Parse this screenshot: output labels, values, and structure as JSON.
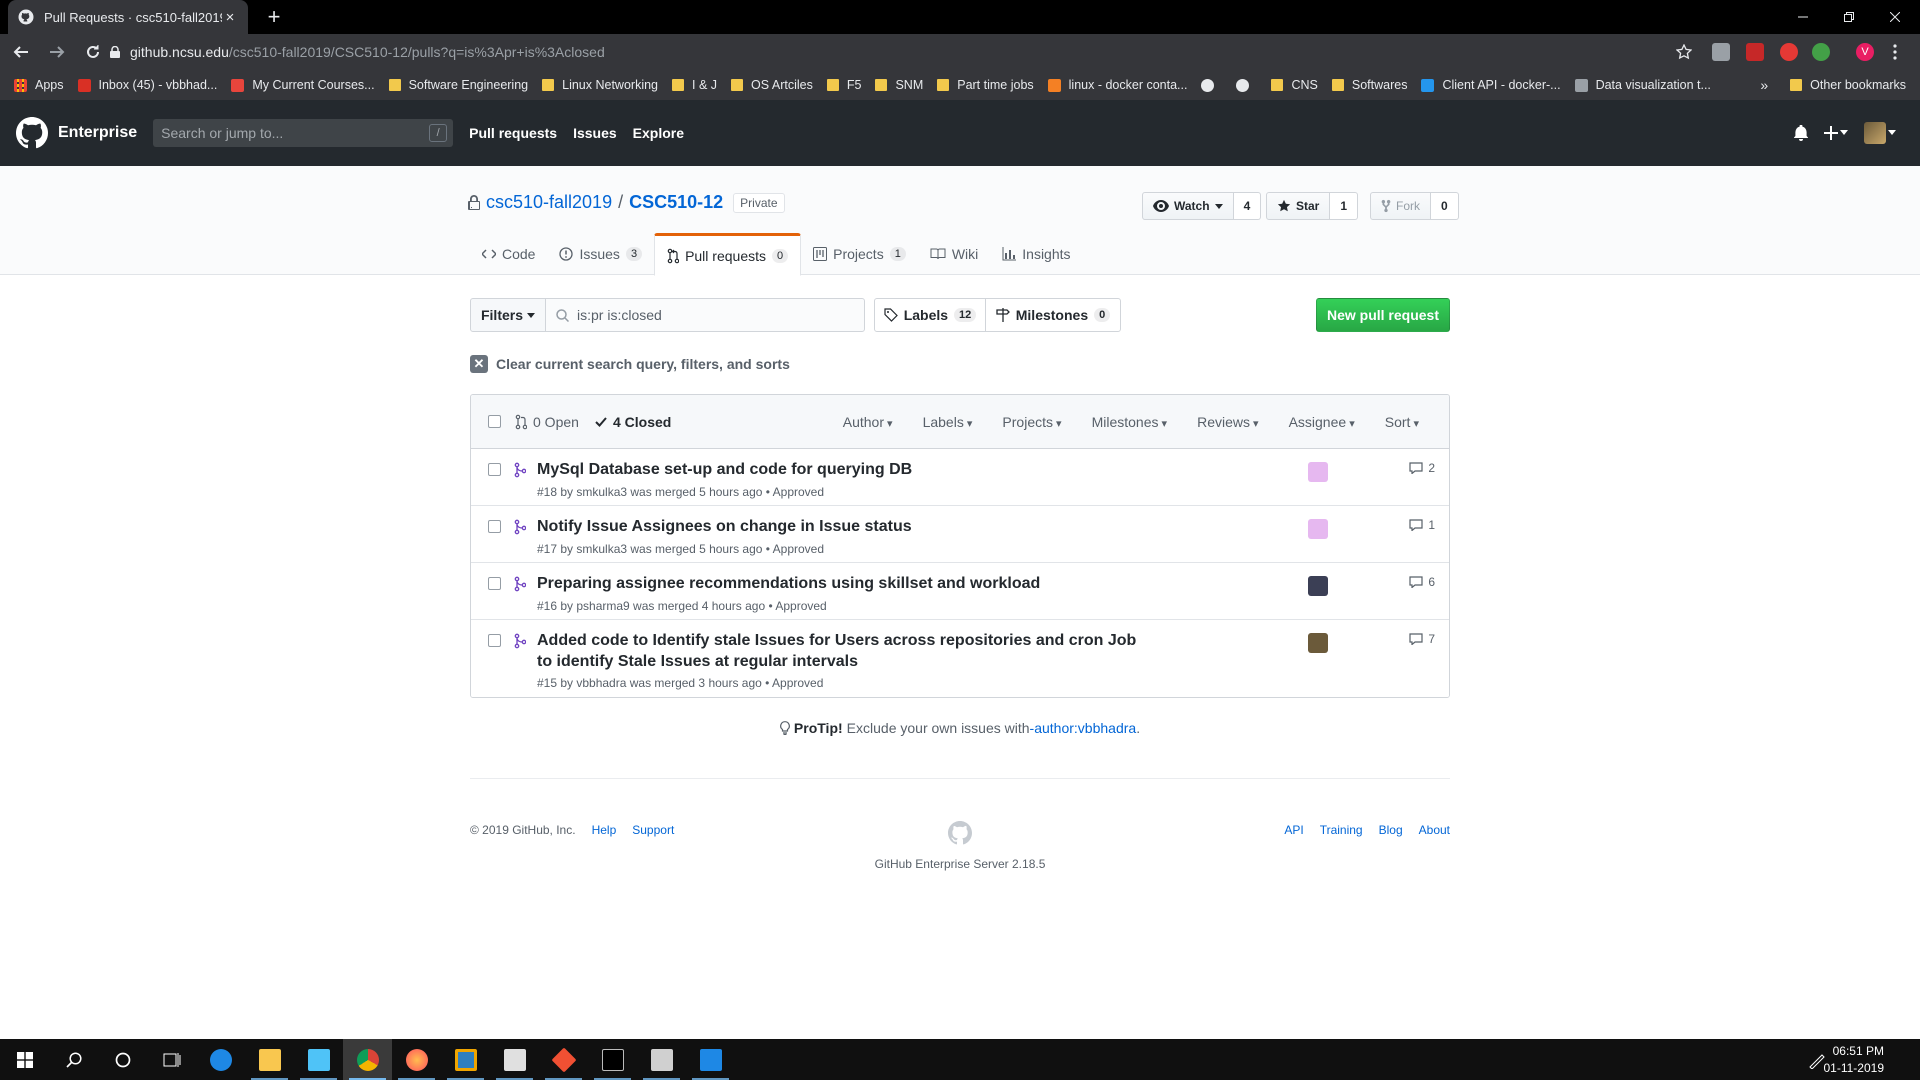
{
  "browser": {
    "tab_title": "Pull Requests · csc510-fall2019/C",
    "tab_close": "×",
    "new_tab": "+",
    "url_host": "github.ncsu.edu",
    "url_path": "/csc510-fall2019/CSC510-12/pulls?q=is%3Apr+is%3Aclosed",
    "bookmarks": [
      {
        "label": "Apps",
        "icon": "apps-grid-icon"
      },
      {
        "label": "Inbox (45) - vbbhad...",
        "icon": "gmail-icon",
        "color": "#d93025"
      },
      {
        "label": "My Current Courses...",
        "icon": "moodle-icon",
        "color": "#e8453c"
      },
      {
        "label": "Software Engineering",
        "icon": "folder-icon"
      },
      {
        "label": "Linux Networking",
        "icon": "folder-icon"
      },
      {
        "label": "I & J",
        "icon": "folder-icon"
      },
      {
        "label": "OS Artciles",
        "icon": "folder-icon"
      },
      {
        "label": "F5",
        "icon": "folder-icon"
      },
      {
        "label": "SNM",
        "icon": "folder-icon"
      },
      {
        "label": "Part time jobs",
        "icon": "folder-icon"
      },
      {
        "label": "linux - docker conta...",
        "icon": "stackoverflow-icon",
        "color": "#f48024"
      },
      {
        "label": "",
        "icon": "globe-icon",
        "color": "#e8eaed"
      },
      {
        "label": "",
        "icon": "github-icon",
        "color": "#e8eaed"
      },
      {
        "label": "CNS",
        "icon": "folder-icon"
      },
      {
        "label": "Softwares",
        "icon": "folder-icon"
      },
      {
        "label": "Client API - docker-...",
        "icon": "docker-icon",
        "color": "#2496ed"
      },
      {
        "label": "Data visualization t...",
        "icon": "page-icon",
        "color": "#9aa0a6"
      }
    ],
    "bookmarks_more": "»",
    "other_bookmarks": "Other bookmarks",
    "profile_initial": "V"
  },
  "gh": {
    "logo_text": "Enterprise",
    "search_placeholder": "Search or jump to...",
    "search_key": "/",
    "nav": [
      "Pull requests",
      "Issues",
      "Explore"
    ]
  },
  "repo": {
    "owner": "csc510-fall2019",
    "separator": "/",
    "name": "CSC510-12",
    "visibility": "Private",
    "watch_label": "Watch",
    "watch_count": "4",
    "star_label": "Star",
    "star_count": "1",
    "fork_label": "Fork",
    "fork_count": "0",
    "tabs": [
      {
        "label": "Code",
        "count": null
      },
      {
        "label": "Issues",
        "count": "3"
      },
      {
        "label": "Pull requests",
        "count": "0"
      },
      {
        "label": "Projects",
        "count": "1"
      },
      {
        "label": "Wiki",
        "count": null
      },
      {
        "label": "Insights",
        "count": null
      }
    ]
  },
  "filters": {
    "filters_label": "Filters",
    "query": "is:pr is:closed",
    "labels_label": "Labels",
    "labels_count": "12",
    "milestones_label": "Milestones",
    "milestones_count": "0",
    "new_pr_label": "New pull request",
    "clear_text": "Clear current search query, filters, and sorts"
  },
  "list": {
    "open_label": "0 Open",
    "closed_label": "4 Closed",
    "menus": [
      "Author",
      "Labels",
      "Projects",
      "Milestones",
      "Reviews",
      "Assignee",
      "Sort"
    ],
    "prs": [
      {
        "title": "MySql Database set-up and code for querying DB",
        "meta": "#18 by smkulka3 was merged 5 hours ago • Approved",
        "comments": "2",
        "avatar_color": "#e6b8f0"
      },
      {
        "title": "Notify Issue Assignees on change in Issue status",
        "meta": "#17 by smkulka3 was merged 5 hours ago • Approved",
        "comments": "1",
        "avatar_color": "#e6b8f0"
      },
      {
        "title": "Preparing assignee recommendations using skillset and workload",
        "meta": "#16 by psharma9 was merged 4 hours ago • Approved",
        "comments": "6",
        "avatar_color": "#3b3f55"
      },
      {
        "title": "Added code to Identify stale Issues for Users across repositories and cron Job to identify Stale Issues at regular intervals",
        "meta": "#15 by vbbhadra was merged 3 hours ago • Approved",
        "comments": "7",
        "avatar_color": "#6b5a3a"
      }
    ]
  },
  "protip": {
    "label": "ProTip!",
    "text": "Exclude your own issues with",
    "link": "-author:vbbhadra",
    "end": "."
  },
  "footer": {
    "copyright": "© 2019 GitHub, Inc.",
    "left_links": [
      "Help",
      "Support"
    ],
    "right_links": [
      "API",
      "Training",
      "Blog",
      "About"
    ],
    "version": "GitHub Enterprise Server 2.18.5"
  },
  "taskbar": {
    "time": "06:51 PM",
    "date": "01-11-2019"
  }
}
